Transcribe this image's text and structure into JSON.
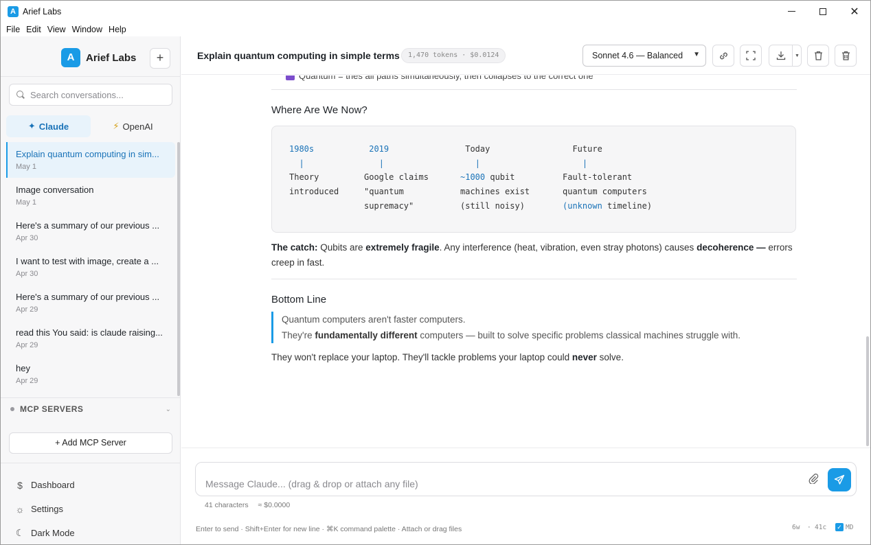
{
  "window": {
    "title": "Arief Labs",
    "app_icon_letter": "A"
  },
  "menu": [
    "File",
    "Edit",
    "View",
    "Window",
    "Help"
  ],
  "sidebar": {
    "brand_letter": "A",
    "brand_name": "Arief Labs",
    "new_chat_label": "+",
    "search_placeholder": "Search conversations...",
    "providers": [
      {
        "icon": "✦",
        "label": "Claude"
      },
      {
        "icon": "⚡",
        "label": "OpenAI"
      }
    ],
    "conversations": [
      {
        "title": "Explain quantum computing in sim...",
        "date": "May 1"
      },
      {
        "title": "Image conversation",
        "date": "May 1"
      },
      {
        "title": "Here's a summary of our previous ...",
        "date": "Apr 30"
      },
      {
        "title": "I want to test with image, create a ...",
        "date": "Apr 30"
      },
      {
        "title": "Here's a summary of our previous ...",
        "date": "Apr 29"
      },
      {
        "title": "read this You said: is claude raising...",
        "date": "Apr 29"
      },
      {
        "title": "hey",
        "date": "Apr 29"
      }
    ],
    "mcp_title": "MCP SERVERS",
    "add_mcp_label": "+ Add MCP Server",
    "nav": [
      {
        "icon": "$",
        "label": "Dashboard"
      },
      {
        "icon": "☼",
        "label": "Settings"
      },
      {
        "icon": "☾",
        "label": "Dark Mode"
      }
    ]
  },
  "header": {
    "chat_title": "Explain quantum computing in simple terms",
    "token_badge": "1,470 tokens · $0.0124",
    "model": "Sonnet 4.6 — Balanced"
  },
  "content": {
    "partial_line": "Quantum = tries all paths simultaneously, then collapses to the correct one",
    "section1_title": "Where Are We Now?",
    "timeline": [
      {
        "era": "1980s",
        "tick": "|",
        "l1": "Theory",
        "l2": "introduced",
        "l3": ""
      },
      {
        "era": "2019",
        "tick": "|",
        "l1": "Google claims",
        "l2": "\"quantum",
        "l3": "supremacy\""
      },
      {
        "era": "Today",
        "tick": "|",
        "l1_blue": "~1000",
        "l1": " qubit",
        "l2": "machines exist",
        "l3": "(still noisy)"
      },
      {
        "era": "Future",
        "tick": "|",
        "l1": "Fault-tolerant",
        "l2": "quantum computers",
        "l3_blue": "(unknown",
        "l3": " timeline)"
      }
    ],
    "catch": {
      "lead": "The catch:",
      "t1": " Qubits are ",
      "b1": "extremely fragile",
      "t2": ". Any interference (heat, vibration, even stray photons) causes ",
      "b2": "decoherence —",
      "t3": " errors creep in fast."
    },
    "section2_title": "Bottom Line",
    "quote_line1": "Quantum computers aren't faster computers.",
    "quote_line2": {
      "t1": "They're ",
      "b1": "fundamentally different",
      "t2": " computers — built to solve specific problems classical machines struggle with."
    },
    "final": {
      "t1": "They won't replace your laptop. They'll tackle problems your laptop could ",
      "b1": "never",
      "t2": " solve."
    }
  },
  "composer": {
    "placeholder": "Message Claude... (drag & drop or attach any file)",
    "char_count": "41 characters",
    "cost": "≈ $0.0000",
    "hint": "Enter to send · Shift+Enter for new line · ⌘K command palette · Attach or drag files",
    "words": "6w",
    "dot": "·",
    "chars": "41c",
    "md_label": "MD"
  },
  "colors": {
    "accent": "#1a9be6",
    "accent_dark": "#1a73b8"
  }
}
